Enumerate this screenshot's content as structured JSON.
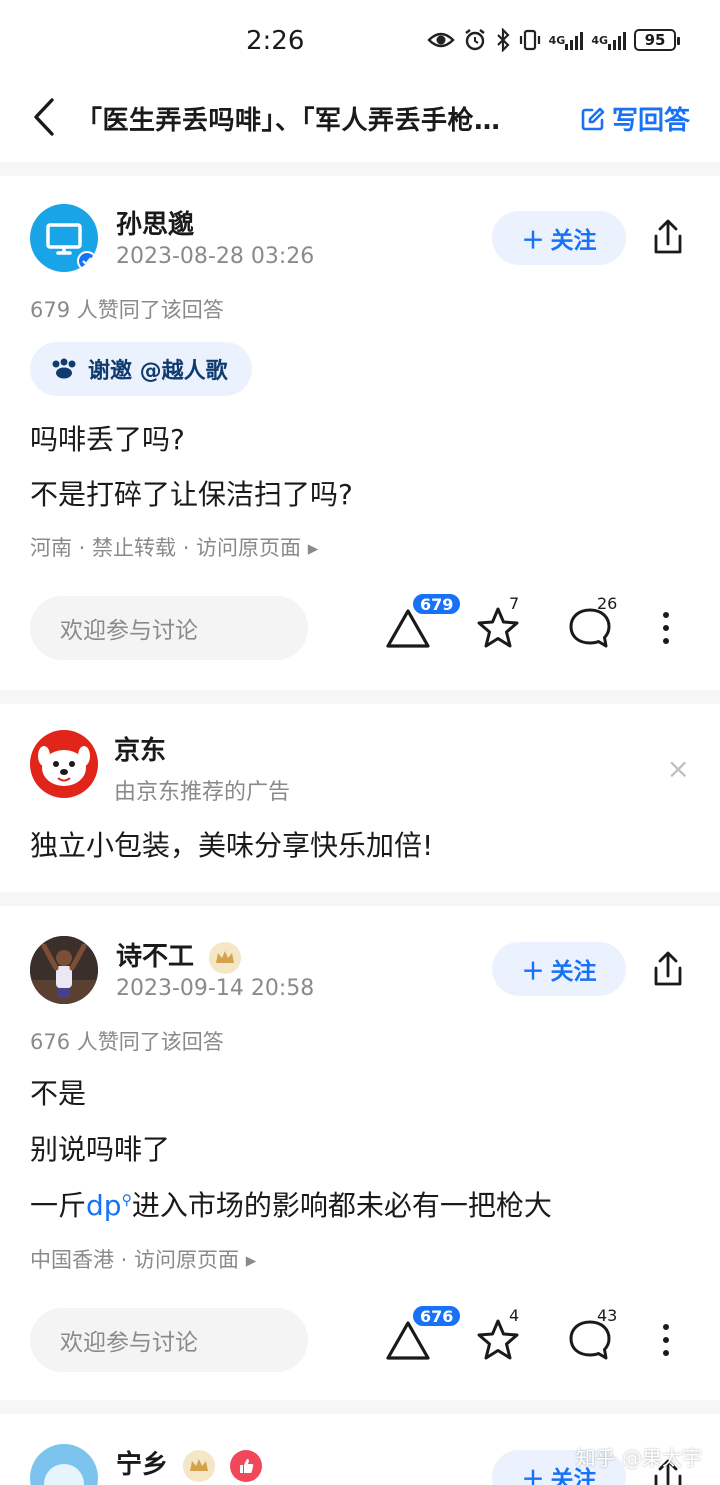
{
  "status_bar": {
    "time": "2:26",
    "network_1": "4G",
    "network_2": "4G",
    "battery": "95"
  },
  "nav": {
    "title": "「医生弄丢吗啡」、「军人弄丢手枪…",
    "write_answer": "写回答"
  },
  "answers": [
    {
      "author": "孙思邈",
      "time": "2023-08-28 03:26",
      "follow": "关注",
      "votes_text": "679 人赞同了该回答",
      "invite": "谢邀 @越人歌",
      "lines": [
        "吗啡丢了吗?",
        "不是打碎了让保洁扫了吗?"
      ],
      "meta": "河南 · 禁止转载 · 访问原页面 ▸",
      "comment_placeholder": "欢迎参与讨论",
      "upvotes": "679",
      "favorites": "7",
      "comments": "26"
    },
    {
      "author": "诗不工",
      "time": "2023-09-14 20:58",
      "follow": "关注",
      "votes_text": "676 人赞同了该回答",
      "line_1": "不是",
      "line_2": "别说吗啡了",
      "line_3_prefix": "一斤",
      "line_3_link": "dp",
      "line_3_suffix": "进入市场的影响都未必有一把枪大",
      "meta": "中国香港 · 访问原页面 ▸",
      "comment_placeholder": "欢迎参与讨论",
      "upvotes": "676",
      "favorites": "4",
      "comments": "43"
    },
    {
      "author": "宁乡",
      "follow": "关注"
    }
  ],
  "ad": {
    "brand": "京东",
    "subtitle": "由京东推荐的广告",
    "text": "独立小包装，美味分享快乐加倍!",
    "close": "×"
  },
  "watermark": "知乎 @果太宇",
  "colors": {
    "accent": "#1772f6",
    "follow_bg": "#ebf2fd",
    "muted": "#8a8a8a",
    "jd_red": "#e1251b"
  }
}
